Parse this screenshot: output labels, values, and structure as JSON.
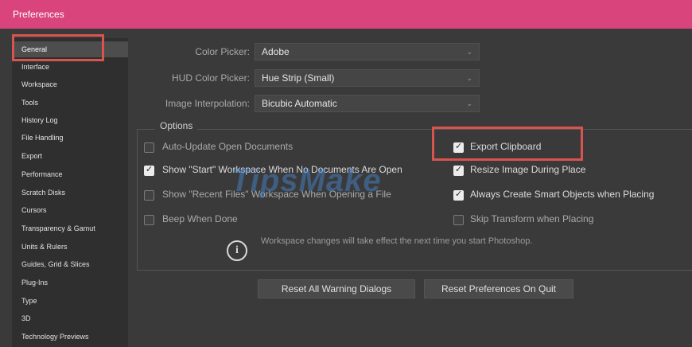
{
  "window": {
    "title": "Preferences"
  },
  "sidebar": {
    "items": [
      {
        "label": "General"
      },
      {
        "label": "Interface"
      },
      {
        "label": "Workspace"
      },
      {
        "label": "Tools"
      },
      {
        "label": "History Log"
      },
      {
        "label": "File Handling"
      },
      {
        "label": "Export"
      },
      {
        "label": "Performance"
      },
      {
        "label": "Scratch Disks"
      },
      {
        "label": "Cursors"
      },
      {
        "label": "Transparency & Gamut"
      },
      {
        "label": "Units & Rulers"
      },
      {
        "label": "Guides, Grid & Slices"
      },
      {
        "label": "Plug-Ins"
      },
      {
        "label": "Type"
      },
      {
        "label": "3D"
      },
      {
        "label": "Technology Previews"
      }
    ],
    "selected": "General"
  },
  "settings": {
    "color_picker": {
      "label": "Color Picker:",
      "value": "Adobe"
    },
    "hud_color_picker": {
      "label": "HUD Color Picker:",
      "value": "Hue Strip (Small)"
    },
    "image_interpolation": {
      "label": "Image Interpolation:",
      "value": "Bicubic Automatic"
    }
  },
  "options": {
    "title": "Options",
    "left": [
      {
        "label": "Auto-Update Open Documents",
        "checked": false
      },
      {
        "label": "Show \"Start\" Workspace When No Documents Are Open",
        "checked": true
      },
      {
        "label": "Show \"Recent Files\" Workspace When Opening a File",
        "checked": false
      },
      {
        "label": "Beep When Done",
        "checked": false
      }
    ],
    "right": [
      {
        "label": "Export Clipboard",
        "checked": true
      },
      {
        "label": "Resize Image During Place",
        "checked": true
      },
      {
        "label": "Always Create Smart Objects when Placing",
        "checked": true
      },
      {
        "label": "Skip Transform when Placing",
        "checked": false
      }
    ],
    "info_text": "Workspace changes will take effect the next time you start Photoshop."
  },
  "buttons": {
    "reset_warnings": "Reset All Warning Dialogs",
    "reset_on_quit": "Reset Preferences On Quit"
  },
  "watermark": "TipsMake",
  "colors": {
    "titlebar": "#d9447c",
    "highlight": "#d9534f",
    "background": "#3a3a3a"
  }
}
